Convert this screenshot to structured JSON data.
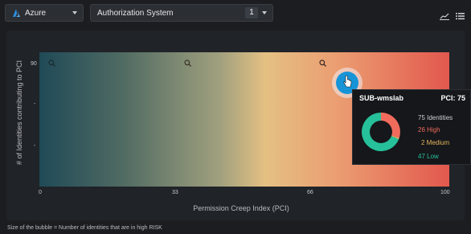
{
  "toolbar": {
    "cloud_label": "Azure",
    "system_label": "Authorization System",
    "system_count": "1",
    "icons": [
      "azure-logo-icon",
      "chevron-down-icon",
      "trend-chart-icon",
      "list-view-icon"
    ]
  },
  "chart_data": {
    "type": "scatter",
    "ylabel": "# of Identities contributing to PCI",
    "xlabel": "Permission Creep Index (PCI)",
    "xlim": [
      0,
      100
    ],
    "x_ticks": [
      "0",
      "33",
      "66",
      "100"
    ],
    "y_ticks": [
      "90"
    ],
    "gradient": [
      "#1f4a57",
      "#e4c083",
      "#e2584d"
    ],
    "points": [
      {
        "name": "SUB-wmslab",
        "x": 75,
        "y": 75,
        "high": 26,
        "medium": 2,
        "low": 47
      }
    ]
  },
  "tooltip": {
    "title": "SUB-wmslab",
    "pci": "PCI: 75",
    "identities": "75 Identities",
    "high": "26 High",
    "medium": "2 Medium",
    "low": "47 Low",
    "colors": {
      "high": "#f06b5c",
      "medium": "#e8b65e",
      "low": "#26c09a"
    }
  },
  "footnote": "Size of the bubble = Number of identities that are in high RISK"
}
